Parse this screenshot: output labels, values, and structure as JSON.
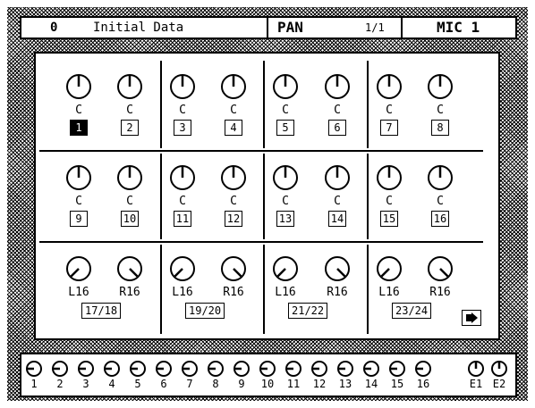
{
  "header": {
    "scene_number": "0",
    "scene_name": "Initial Data",
    "page_title": "PAN",
    "page_indicator": "1/1",
    "channel_name": "MIC 1"
  },
  "rows": [
    {
      "knobs": [
        {
          "label": "C",
          "channel": "1",
          "selected": true
        },
        {
          "label": "C",
          "channel": "2"
        },
        {
          "label": "C",
          "channel": "3"
        },
        {
          "label": "C",
          "channel": "4"
        },
        {
          "label": "C",
          "channel": "5"
        },
        {
          "label": "C",
          "channel": "6"
        },
        {
          "label": "C",
          "channel": "7"
        },
        {
          "label": "C",
          "channel": "8"
        }
      ]
    },
    {
      "knobs": [
        {
          "label": "C",
          "channel": "9"
        },
        {
          "label": "C",
          "channel": "10"
        },
        {
          "label": "C",
          "channel": "11"
        },
        {
          "label": "C",
          "channel": "12"
        },
        {
          "label": "C",
          "channel": "13"
        },
        {
          "label": "C",
          "channel": "14"
        },
        {
          "label": "C",
          "channel": "15"
        },
        {
          "label": "C",
          "channel": "16"
        }
      ]
    },
    {
      "knobs": [
        {
          "label": "L16"
        },
        {
          "label": "R16"
        },
        {
          "label": "L16"
        },
        {
          "label": "R16"
        },
        {
          "label": "L16"
        },
        {
          "label": "R16"
        },
        {
          "label": "L16"
        },
        {
          "label": "R16"
        }
      ],
      "pairs": [
        "17/18",
        "19/20",
        "21/22",
        "23/24"
      ]
    }
  ],
  "bottom_strip": {
    "labels": [
      "1",
      "2",
      "3",
      "4",
      "5",
      "6",
      "7",
      "8",
      "9",
      "10",
      "11",
      "12",
      "13",
      "14",
      "15",
      "16",
      "E1",
      "E2"
    ]
  },
  "next_page_icon": "arrow-right-icon"
}
